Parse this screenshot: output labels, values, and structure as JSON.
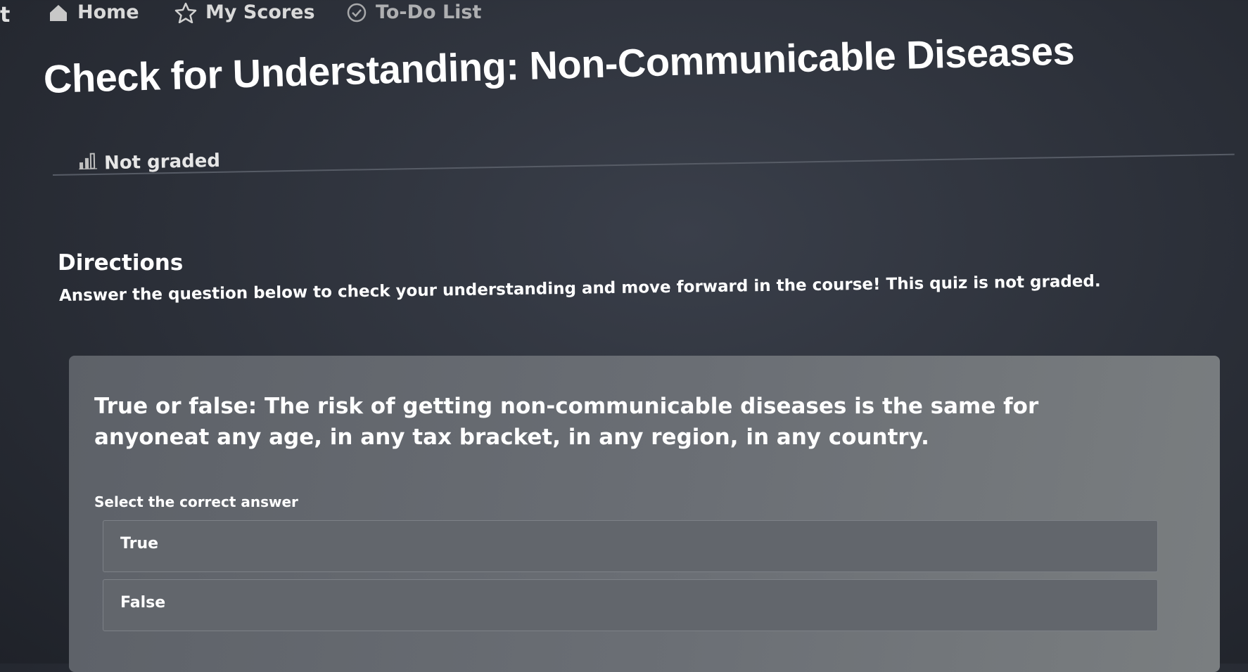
{
  "nav": {
    "back": "t",
    "home": "Home",
    "scores": "My Scores",
    "todo": "To-Do List"
  },
  "page": {
    "title": "Check for Understanding: Non-Communicable Diseases",
    "grading": "Not graded"
  },
  "directions": {
    "title": "Directions",
    "text": "Answer the question below to check your understanding and move forward in the course! This quiz is not graded."
  },
  "question": {
    "text": "True or false: The risk of getting non-communicable diseases is the same for anyoneat any age, in any tax bracket, in any region, in any country.",
    "prompt": "Select the correct answer",
    "options": [
      "True",
      "False"
    ]
  },
  "icons": {
    "home": "home-icon",
    "scores": "star-icon",
    "todo": "check-circle-icon",
    "grading": "bar-chart-icon"
  }
}
